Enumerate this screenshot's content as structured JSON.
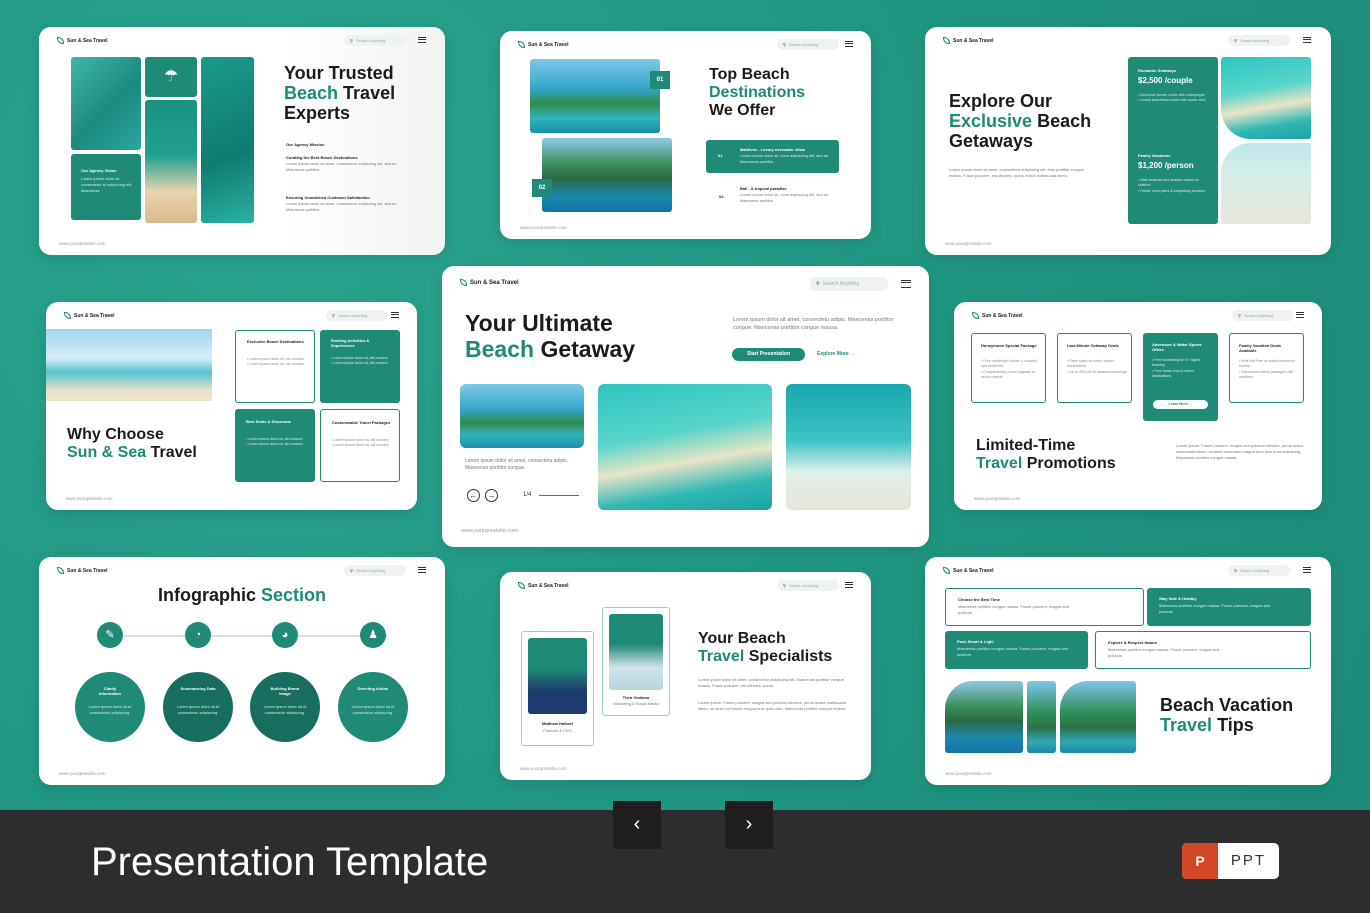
{
  "brand": "Sun & Sea Travel",
  "search_placeholder": "Search Anything",
  "website": "www.yourgreatsite.com",
  "slides": {
    "s1": {
      "title1": "Your Trusted",
      "title2": "Beach",
      "title3": "Travel",
      "title4": "Experts",
      "mission": "Our Agency Mission",
      "item1": "Curating the Best Beach Destinations",
      "item1_text": "Lorem ipsum dolor sit amet, consectetur adipiscing elit, sed do Maecenas porttitor.",
      "item2": "Ensuring Unmatched Customer Satisfaction",
      "item2_text": "Lorem ipsum dolor sit amet, consectetur adipiscing elit, sed do Maecenas porttitor.",
      "vision": "Our Agency Vision",
      "vision_text": "Lorem ipsum dolor sit, consectetur et adipiscing elit, Maecenas"
    },
    "s2": {
      "title1": "Top Beach",
      "title2": "Destinations",
      "title3": "We Offer",
      "n1": "01",
      "n2": "02",
      "d1_num": "01.",
      "d1": "Maldives - Luxury overwater villas",
      "d1_text": "Lorem ipsum dolor sit, cons adipiscing elit, sed do Maecenas porttitor.",
      "d2_num": "02.",
      "d2": "Bali - A tropical paradise",
      "d2_text": "Lorem ipsum dolor sit, cons adipiscing elit, sed do Maecenas porttitor."
    },
    "s3": {
      "title1": "Explore Our",
      "title2": "Exclusive",
      "title3": "Beach",
      "title4": "Getaways",
      "desc": "Lorem ipsum dolor sit amet, consectetur adipiscing elit. Mas porttitor congue massa. Fusce posuere, est ultricies, purus lectus malesuada libero.",
      "p1": "Romantic Getaways",
      "p1_price": "$2,500 /couple",
      "p1_b1": "Exclusive sunset cruise with champagne",
      "p1_b2": "Luxury beachfront resort with ocean view",
      "p2": "Family Vacations",
      "p2_price": "$1,200 /person",
      "p2_b1": "Safe beaches and shallow waters for children",
      "p2_b2": "Family meal plans & babysitting services"
    },
    "s4": {
      "title1": "Why Choose",
      "title2": "Sun & Sea",
      "title3": "Travel",
      "c1": "Exclusive Beach Destinations",
      "c2": "Exciting Activities & Experiences",
      "c3": "Best Deals & Discounts",
      "c4": "Customizable Travel Packages",
      "b1": "Lorem ipsum dolor sit, elit consect",
      "b2": "Lorem ipsum dolor sit, elit consect"
    },
    "s5": {
      "title1": "Your Ultimate",
      "title2": "Beach",
      "title3": "Getaway",
      "desc": "Lorem ipsum dolor sit amet, consectetu adipis. Maecenas porttitor congue. Maecenas porttitor congue massa.",
      "btn1": "Start Presentation",
      "btn2": "Explore More",
      "cap": "Lorem ipsum dolor sit amet, consectetu adipis. Maecenas porttitor congue.",
      "page": "1/4"
    },
    "s6": {
      "title1": "Limited-Time",
      "title2": "Travel",
      "title3": "Promotions",
      "desc": "Lorem ipsum. Fusce posuere, magna sed pulvinar ultricies, purus lectus malesuada libero, sit amet commodo magna eros quis urna adipiscing. Maecenas porttitor congue massa.",
      "c1": "Honeymoon Special Package",
      "c1_b1": "Free candlelight dinner & couples' spa treatment",
      "c1_b2": "Complimentary room upgrade at select resorts",
      "c2": "Last-Minute Getaway Deals",
      "c2_b1": "Flash sales on select beach destinations",
      "c2_b2": "Up to 40% off on weekend bookings",
      "c3": "Adventure & Water Sports Offers",
      "c3_b1": "Free snorkeling for 5+ nights booking",
      "c3_b2": "Free beach tour in select destinations",
      "c3_btn": "Learn More",
      "c4": "Family Vacation Deals Available",
      "c4_b1": "Kids Eat Free at select beachfront resorts",
      "c4_b2": "Discounted family packages with activities"
    },
    "s7": {
      "title1": "Infographic",
      "title2": "Section",
      "i1": "Clarify Information",
      "i2": "Summarizing Data",
      "i3": "Building Brand Image",
      "i4": "Directing Action",
      "itext": "Lorem ipsum dolor sit et consectetur adipiscing."
    },
    "s8": {
      "title1": "Your Beach",
      "title2": "Travel",
      "title3": "Specialists",
      "p1": "Matthew Halbert",
      "p1_role": "Founder & CEO",
      "p2": "Theo Omilano",
      "p2_role": "Marketing & Social Media",
      "desc1": "Lorem ipsum dolor sit amet, consectetur adipiscing elit. Maecenas porttitor congue massa. Fusce posuere, est ultricies, purus.",
      "desc2": "Lorem ipsum. Fusce posuere, magna sed pulvinar ultricies, purus lectus malesuada libero, sit amet commodo magna eros quis urna. Maecenas porttitor congue massa."
    },
    "s9": {
      "title1": "Beach Vacation",
      "title2": "Travel",
      "title3": "Tips",
      "t1": "Choose the Best Time",
      "t2": "Stay Safe & Healthy",
      "t3": "Pack Smart & Light",
      "t4": "Explore & Respect Nature",
      "ttext": "Maecenas porttitor congue massa. Fusce posuere, magna sed pulvinar"
    }
  },
  "footer": {
    "title": "Presentation Template",
    "badge": "PPT",
    "badge_icon": "P",
    "prev": "‹",
    "next": "›"
  },
  "colors": {
    "accent": "#1f8a76",
    "background": "#259a85",
    "footer": "#2d2d2d"
  }
}
